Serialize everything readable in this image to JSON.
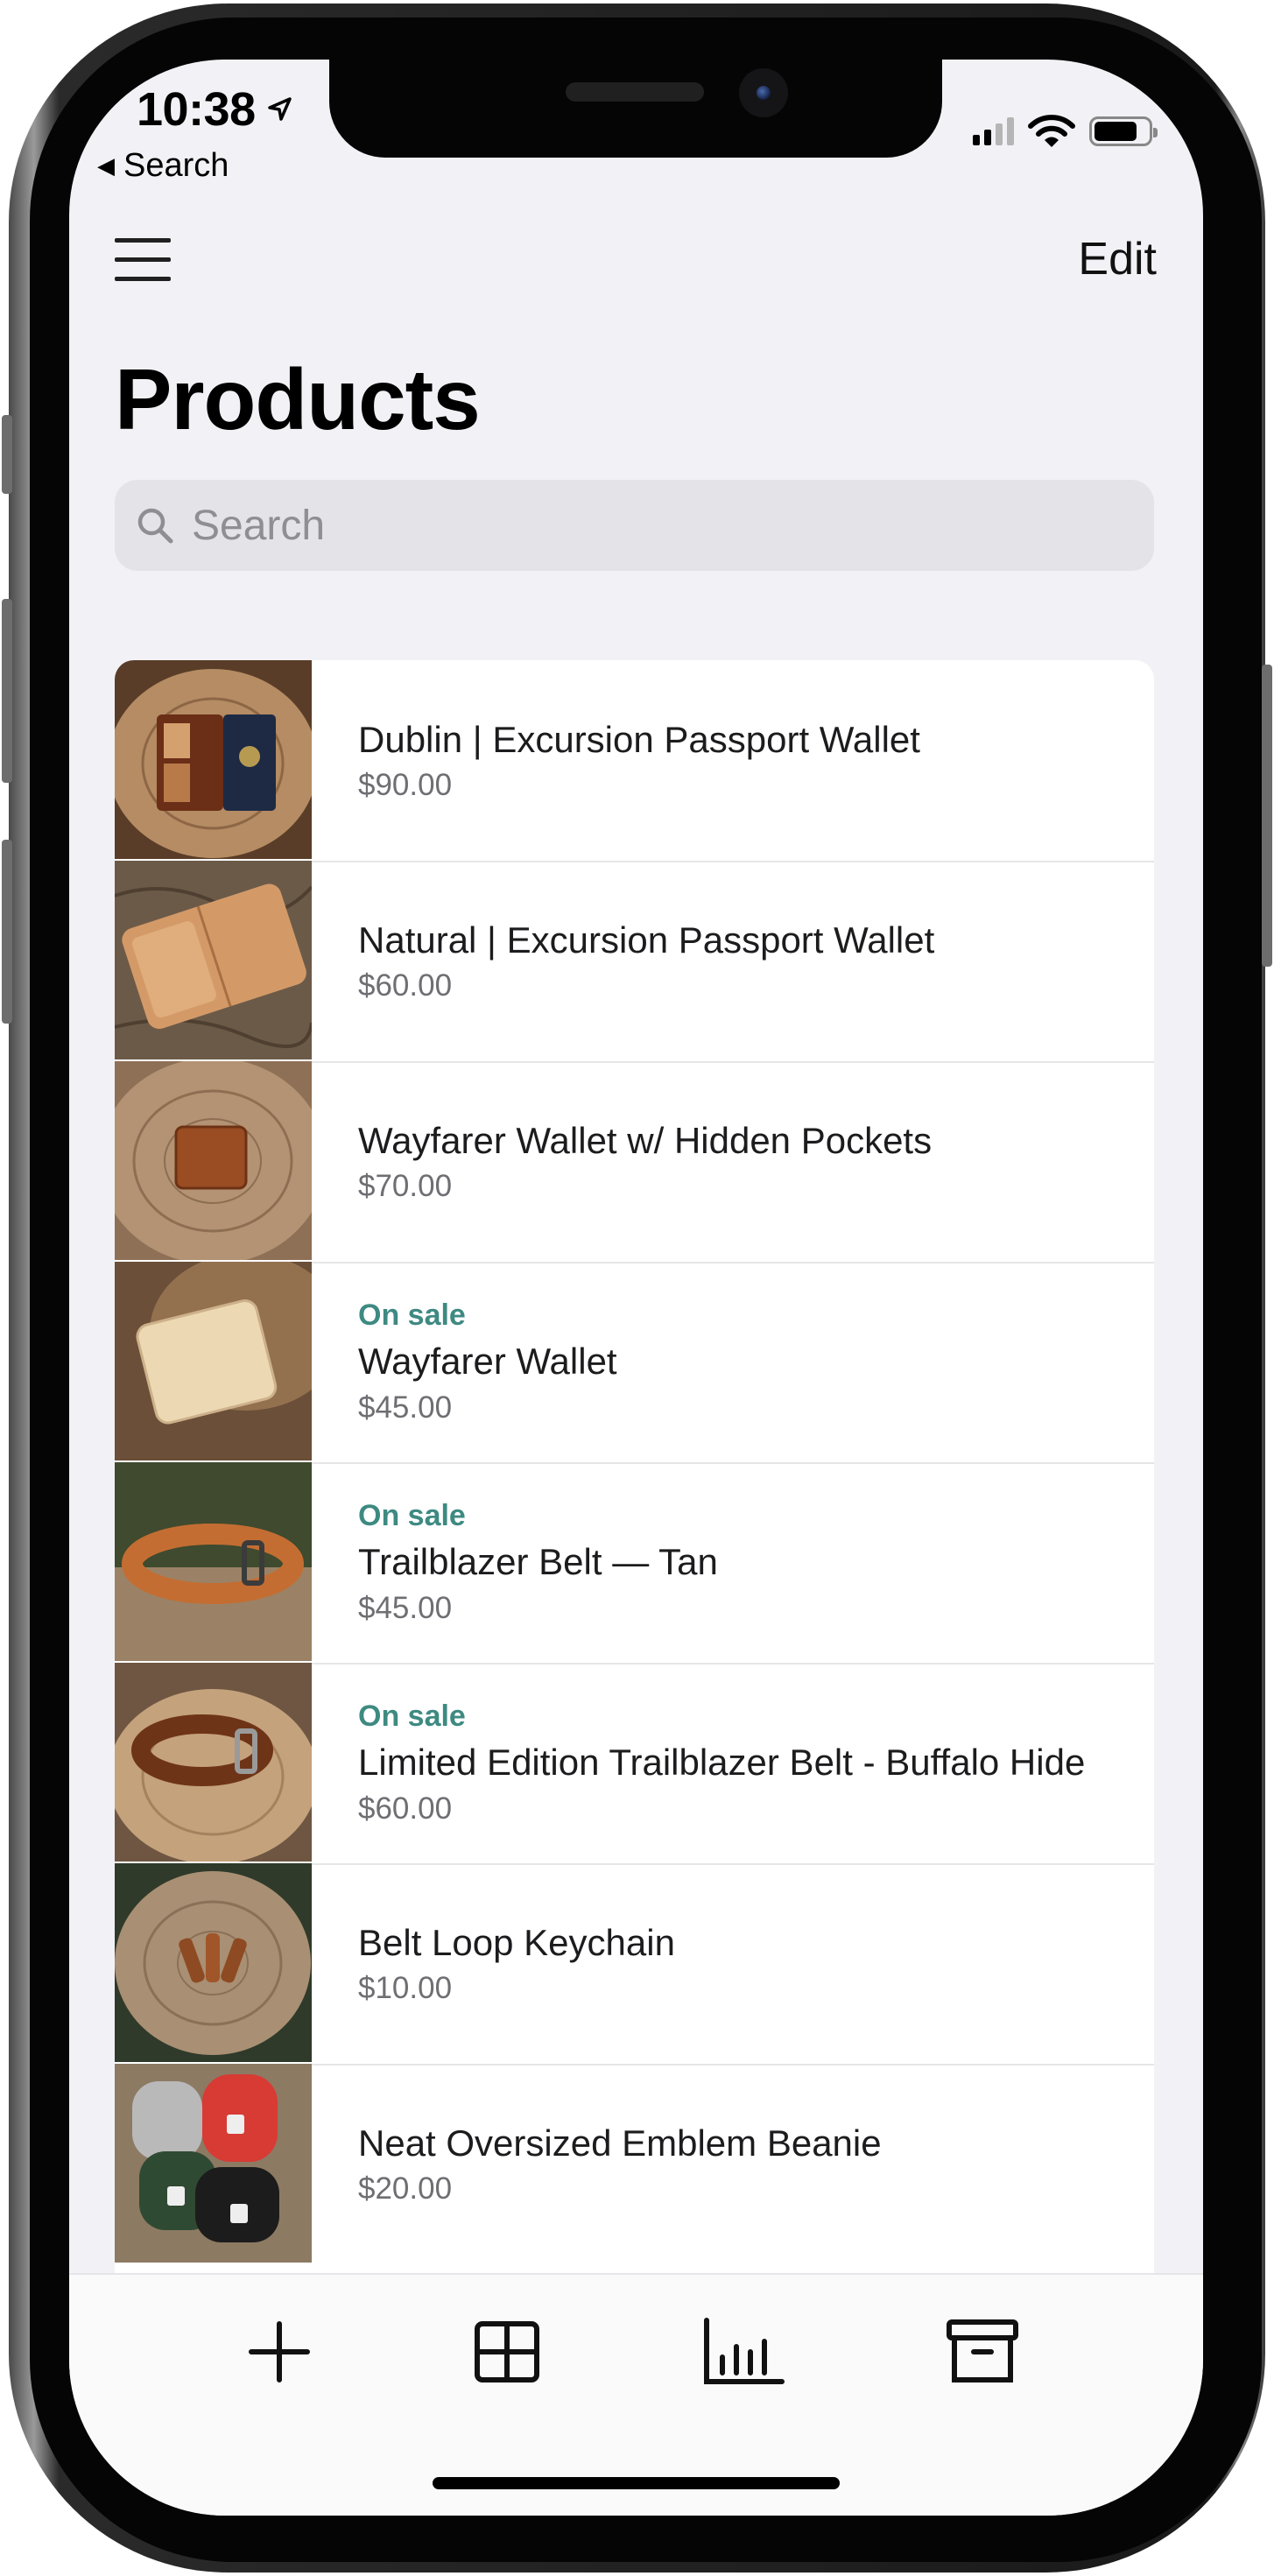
{
  "status_bar": {
    "time": "10:38",
    "back_label": "Search"
  },
  "nav": {
    "edit_label": "Edit",
    "title": "Products"
  },
  "search": {
    "placeholder": "Search"
  },
  "products": [
    {
      "name": "Dublin | Excursion Passport Wallet",
      "price": "$90.00",
      "badge": ""
    },
    {
      "name": "Natural | Excursion Passport Wallet",
      "price": "$60.00",
      "badge": ""
    },
    {
      "name": "Wayfarer Wallet w/ Hidden Pockets",
      "price": "$70.00",
      "badge": ""
    },
    {
      "name": "Wayfarer Wallet",
      "price": "$45.00",
      "badge": "On sale"
    },
    {
      "name": "Trailblazer Belt — Tan",
      "price": "$45.00",
      "badge": "On sale"
    },
    {
      "name": "Limited Edition Trailblazer Belt - Buffalo Hide",
      "price": "$60.00",
      "badge": "On sale"
    },
    {
      "name": "Belt Loop Keychain",
      "price": "$10.00",
      "badge": ""
    },
    {
      "name": "Neat Oversized Emblem Beanie",
      "price": "$20.00",
      "badge": ""
    }
  ],
  "tab_bar": {
    "icons": [
      "plus-icon",
      "grid-icon",
      "bar-chart-icon",
      "archive-box-icon"
    ]
  },
  "colors": {
    "accent_on_sale": "#3e8a82",
    "screen_background": "#f2f2f6",
    "search_background": "#e3e3e8"
  }
}
